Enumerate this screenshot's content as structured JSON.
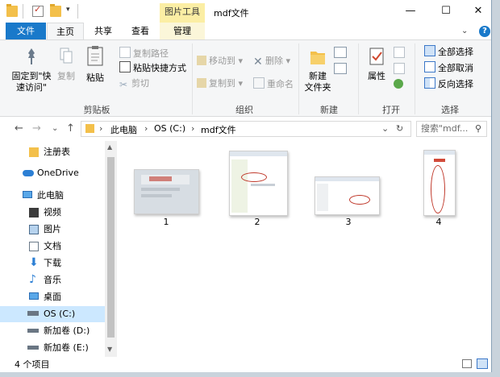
{
  "titlebar": {
    "context_tab": "图片工具",
    "title": "mdf文件",
    "minimize": "—",
    "maximize": "☐",
    "close": "✕"
  },
  "tabs": {
    "file": "文件",
    "home": "主页",
    "share": "共享",
    "view": "查看",
    "manage": "管理",
    "collapse": "⌄",
    "help": "?"
  },
  "ribbon": {
    "clipboard": {
      "pin": "固定到\"快\n速访问\"",
      "copy": "复制",
      "paste": "粘贴",
      "copy_path": "复制路径",
      "paste_shortcut": "粘贴快捷方式",
      "cut": "剪切",
      "label": "剪贴板"
    },
    "organize": {
      "move_to": "移动到",
      "copy_to": "复制到",
      "delete": "删除",
      "rename": "重命名",
      "label": "组织"
    },
    "new": {
      "new_folder": "新建\n文件夹",
      "label": "新建"
    },
    "open": {
      "properties": "属性",
      "label": "打开"
    },
    "select": {
      "select_all": "全部选择",
      "select_none": "全部取消",
      "invert": "反向选择",
      "label": "选择"
    }
  },
  "address": {
    "back": "←",
    "forward": "→",
    "recent": "⌄",
    "up": "↑",
    "crumbs": [
      "此电脑",
      "OS (C:)",
      "mdf文件"
    ],
    "refresh": "↻",
    "search_placeholder": "搜索\"mdf..."
  },
  "nav": {
    "items": [
      {
        "label": "注册表",
        "icon": "folder-icon"
      },
      {
        "label": "OneDrive",
        "icon": "cloud-icon"
      },
      {
        "label": "此电脑",
        "icon": "computer-icon"
      },
      {
        "label": "视频",
        "icon": "video-icon"
      },
      {
        "label": "图片",
        "icon": "picture-icon"
      },
      {
        "label": "文档",
        "icon": "document-icon"
      },
      {
        "label": "下载",
        "icon": "download-icon"
      },
      {
        "label": "音乐",
        "icon": "music-icon"
      },
      {
        "label": "桌面",
        "icon": "desktop-icon"
      },
      {
        "label": "OS (C:)",
        "icon": "drive-icon"
      },
      {
        "label": "新加卷 (D:)",
        "icon": "drive-icon"
      },
      {
        "label": "新加卷 (E:)",
        "icon": "drive-icon"
      }
    ],
    "selected": "OS (C:)"
  },
  "files": [
    {
      "name": "1"
    },
    {
      "name": "2"
    },
    {
      "name": "3"
    },
    {
      "name": "4"
    }
  ],
  "status": {
    "count": "4 个项目"
  },
  "colors": {
    "accent": "#1979ca",
    "context_tab": "#fbeea4",
    "selected_nav": "#cce8ff",
    "folder": "#f3c04b"
  }
}
